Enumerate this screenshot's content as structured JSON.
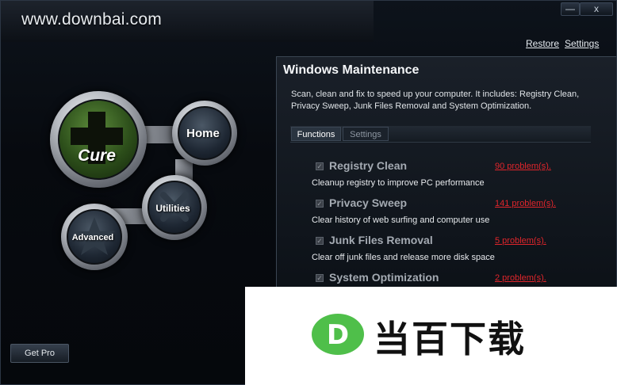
{
  "header": {
    "site_title": "www.downbai.com",
    "minimize_label": "—",
    "close_label": "x",
    "restore_link": "Restore",
    "settings_link": "Settings"
  },
  "nav": {
    "cure": "Cure",
    "home": "Home",
    "utilities": "Utilities",
    "advanced": "Advanced"
  },
  "panel": {
    "title": "Windows Maintenance",
    "description": "Scan, clean and fix to speed up your computer. It includes: Registry Clean, Privacy Sweep, Junk Files Removal and System Optimization.",
    "tabs": [
      {
        "label": "Functions",
        "active": true
      },
      {
        "label": "Settings",
        "active": false
      }
    ],
    "items": [
      {
        "name": "Registry Clean",
        "problems": "90 problem(s).",
        "description": "Cleanup registry to improve PC performance",
        "checked": true
      },
      {
        "name": "Privacy Sweep",
        "problems": "141 problem(s).",
        "description": "Clear history of web surfing and computer use",
        "checked": true
      },
      {
        "name": "Junk Files Removal",
        "problems": "5 problem(s).",
        "description": "Clear off junk files and release more disk space",
        "checked": true
      },
      {
        "name": "System Optimization",
        "problems": "2 problem(s).",
        "description": "",
        "checked": true
      }
    ]
  },
  "footer": {
    "get_pro_label": "Get Pro"
  },
  "watermark": {
    "text": "当百下载",
    "logo_letter": "D"
  },
  "colors": {
    "accent_problem": "#e0252b",
    "cure_green": "#3f6f25",
    "watermark_green": "#4fbf4a"
  }
}
